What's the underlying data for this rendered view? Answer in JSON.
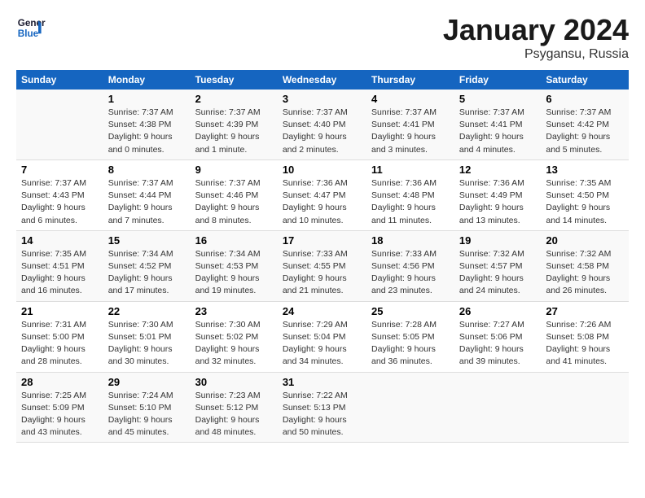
{
  "header": {
    "logo_line1": "General",
    "logo_line2": "Blue",
    "title": "January 2024",
    "subtitle": "Psygansu, Russia"
  },
  "columns": [
    "Sunday",
    "Monday",
    "Tuesday",
    "Wednesday",
    "Thursday",
    "Friday",
    "Saturday"
  ],
  "weeks": [
    [
      {
        "day": "",
        "info": ""
      },
      {
        "day": "1",
        "info": "Sunrise: 7:37 AM\nSunset: 4:38 PM\nDaylight: 9 hours\nand 0 minutes."
      },
      {
        "day": "2",
        "info": "Sunrise: 7:37 AM\nSunset: 4:39 PM\nDaylight: 9 hours\nand 1 minute."
      },
      {
        "day": "3",
        "info": "Sunrise: 7:37 AM\nSunset: 4:40 PM\nDaylight: 9 hours\nand 2 minutes."
      },
      {
        "day": "4",
        "info": "Sunrise: 7:37 AM\nSunset: 4:41 PM\nDaylight: 9 hours\nand 3 minutes."
      },
      {
        "day": "5",
        "info": "Sunrise: 7:37 AM\nSunset: 4:41 PM\nDaylight: 9 hours\nand 4 minutes."
      },
      {
        "day": "6",
        "info": "Sunrise: 7:37 AM\nSunset: 4:42 PM\nDaylight: 9 hours\nand 5 minutes."
      }
    ],
    [
      {
        "day": "7",
        "info": "Sunrise: 7:37 AM\nSunset: 4:43 PM\nDaylight: 9 hours\nand 6 minutes."
      },
      {
        "day": "8",
        "info": "Sunrise: 7:37 AM\nSunset: 4:44 PM\nDaylight: 9 hours\nand 7 minutes."
      },
      {
        "day": "9",
        "info": "Sunrise: 7:37 AM\nSunset: 4:46 PM\nDaylight: 9 hours\nand 8 minutes."
      },
      {
        "day": "10",
        "info": "Sunrise: 7:36 AM\nSunset: 4:47 PM\nDaylight: 9 hours\nand 10 minutes."
      },
      {
        "day": "11",
        "info": "Sunrise: 7:36 AM\nSunset: 4:48 PM\nDaylight: 9 hours\nand 11 minutes."
      },
      {
        "day": "12",
        "info": "Sunrise: 7:36 AM\nSunset: 4:49 PM\nDaylight: 9 hours\nand 13 minutes."
      },
      {
        "day": "13",
        "info": "Sunrise: 7:35 AM\nSunset: 4:50 PM\nDaylight: 9 hours\nand 14 minutes."
      }
    ],
    [
      {
        "day": "14",
        "info": "Sunrise: 7:35 AM\nSunset: 4:51 PM\nDaylight: 9 hours\nand 16 minutes."
      },
      {
        "day": "15",
        "info": "Sunrise: 7:34 AM\nSunset: 4:52 PM\nDaylight: 9 hours\nand 17 minutes."
      },
      {
        "day": "16",
        "info": "Sunrise: 7:34 AM\nSunset: 4:53 PM\nDaylight: 9 hours\nand 19 minutes."
      },
      {
        "day": "17",
        "info": "Sunrise: 7:33 AM\nSunset: 4:55 PM\nDaylight: 9 hours\nand 21 minutes."
      },
      {
        "day": "18",
        "info": "Sunrise: 7:33 AM\nSunset: 4:56 PM\nDaylight: 9 hours\nand 23 minutes."
      },
      {
        "day": "19",
        "info": "Sunrise: 7:32 AM\nSunset: 4:57 PM\nDaylight: 9 hours\nand 24 minutes."
      },
      {
        "day": "20",
        "info": "Sunrise: 7:32 AM\nSunset: 4:58 PM\nDaylight: 9 hours\nand 26 minutes."
      }
    ],
    [
      {
        "day": "21",
        "info": "Sunrise: 7:31 AM\nSunset: 5:00 PM\nDaylight: 9 hours\nand 28 minutes."
      },
      {
        "day": "22",
        "info": "Sunrise: 7:30 AM\nSunset: 5:01 PM\nDaylight: 9 hours\nand 30 minutes."
      },
      {
        "day": "23",
        "info": "Sunrise: 7:30 AM\nSunset: 5:02 PM\nDaylight: 9 hours\nand 32 minutes."
      },
      {
        "day": "24",
        "info": "Sunrise: 7:29 AM\nSunset: 5:04 PM\nDaylight: 9 hours\nand 34 minutes."
      },
      {
        "day": "25",
        "info": "Sunrise: 7:28 AM\nSunset: 5:05 PM\nDaylight: 9 hours\nand 36 minutes."
      },
      {
        "day": "26",
        "info": "Sunrise: 7:27 AM\nSunset: 5:06 PM\nDaylight: 9 hours\nand 39 minutes."
      },
      {
        "day": "27",
        "info": "Sunrise: 7:26 AM\nSunset: 5:08 PM\nDaylight: 9 hours\nand 41 minutes."
      }
    ],
    [
      {
        "day": "28",
        "info": "Sunrise: 7:25 AM\nSunset: 5:09 PM\nDaylight: 9 hours\nand 43 minutes."
      },
      {
        "day": "29",
        "info": "Sunrise: 7:24 AM\nSunset: 5:10 PM\nDaylight: 9 hours\nand 45 minutes."
      },
      {
        "day": "30",
        "info": "Sunrise: 7:23 AM\nSunset: 5:12 PM\nDaylight: 9 hours\nand 48 minutes."
      },
      {
        "day": "31",
        "info": "Sunrise: 7:22 AM\nSunset: 5:13 PM\nDaylight: 9 hours\nand 50 minutes."
      },
      {
        "day": "",
        "info": ""
      },
      {
        "day": "",
        "info": ""
      },
      {
        "day": "",
        "info": ""
      }
    ]
  ]
}
